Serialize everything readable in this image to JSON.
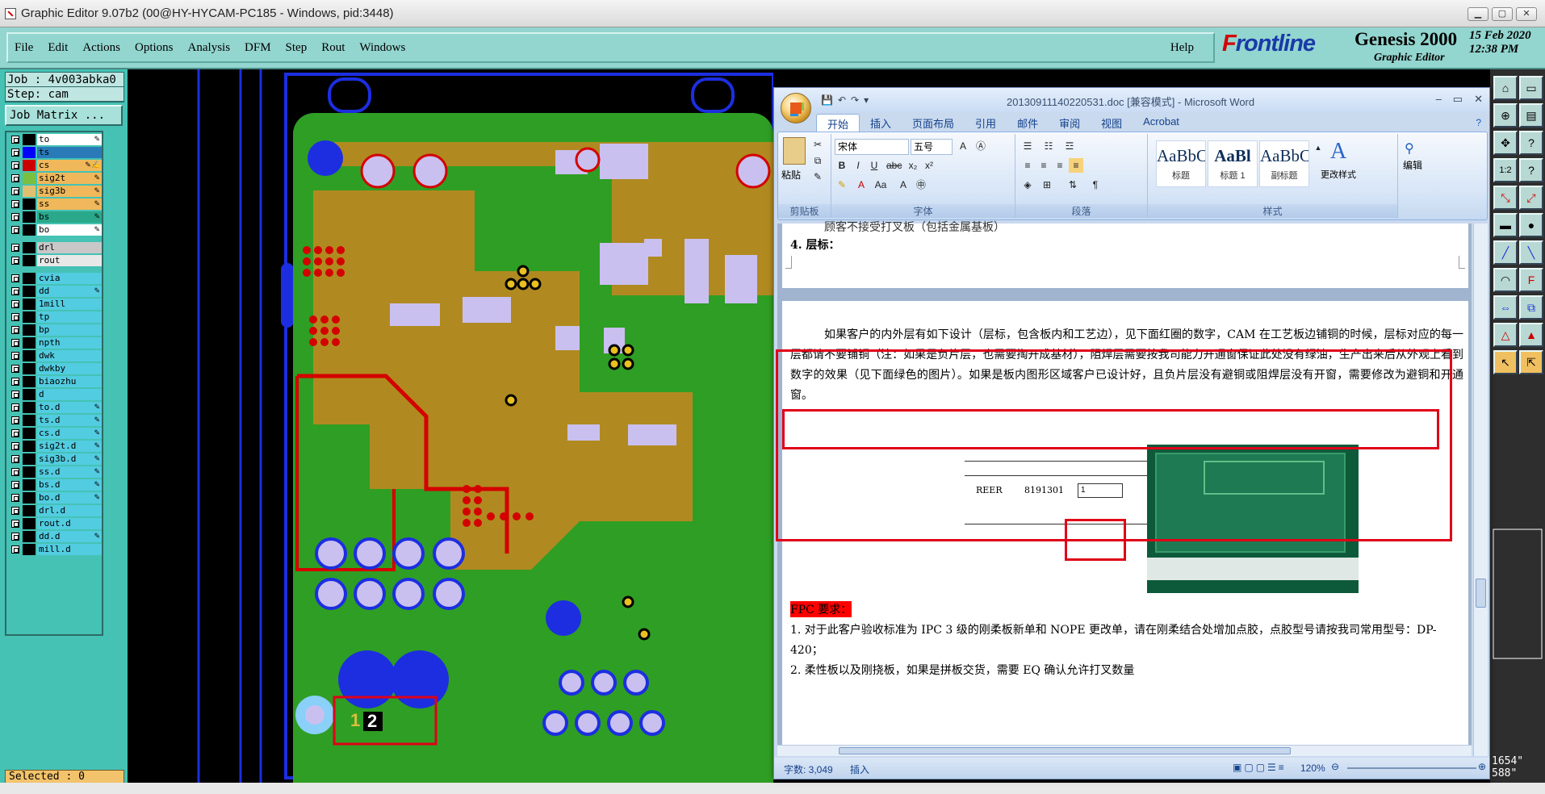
{
  "window": {
    "title": "Graphic Editor 9.07b2 (00@HY-HYCAM-PC185 - Windows, pid:3448)"
  },
  "menu": [
    "File",
    "Edit",
    "Actions",
    "Options",
    "Analysis",
    "DFM",
    "Step",
    "Rout",
    "Windows"
  ],
  "help": "Help",
  "brand": {
    "logo": "Frontline",
    "product": "Genesis 2000",
    "subtitle": "Graphic Editor",
    "date": "15 Feb 2020\n12:38 PM"
  },
  "job": {
    "job": "Job : 4v003abka0",
    "step": "Step: cam",
    "matrix_button": "Job Matrix ..."
  },
  "layers": [
    {
      "name": "to",
      "color": "#ffffff",
      "swatch": "#000000",
      "edit": "✎"
    },
    {
      "name": "ts",
      "color": "#2a7ab8",
      "swatch": "#0000ff",
      "edit": ""
    },
    {
      "name": "cs",
      "color": "#f0b85a",
      "swatch": "#cc0000",
      "edit": "✎✍"
    },
    {
      "name": "sig2t",
      "color": "#f0b85a",
      "swatch": "#7ac040",
      "edit": "✎"
    },
    {
      "name": "sig3b",
      "color": "#f0b85a",
      "swatch": "#e0c070",
      "edit": "✎"
    },
    {
      "name": "ss",
      "color": "#f0b85a",
      "swatch": "#000000",
      "edit": "✎"
    },
    {
      "name": "bs",
      "color": "#2aa88a",
      "swatch": "#000000",
      "edit": "✎"
    },
    {
      "name": "bo",
      "color": "#ffffff",
      "swatch": "#000000",
      "edit": "✎"
    },
    {
      "name": "drl",
      "color": "#c8c8c8",
      "swatch": "#000000",
      "edit": ""
    },
    {
      "name": "rout",
      "color": "#e8e8e8",
      "swatch": "#000000",
      "edit": ""
    },
    {
      "name": "cvia",
      "color": "#52cce0",
      "swatch": "#000000",
      "edit": ""
    },
    {
      "name": "dd",
      "color": "#52cce0",
      "swatch": "#000000",
      "edit": "✎"
    },
    {
      "name": "1mill",
      "color": "#52cce0",
      "swatch": "#000000",
      "edit": ""
    },
    {
      "name": "tp",
      "color": "#52cce0",
      "swatch": "#000000",
      "edit": ""
    },
    {
      "name": "bp",
      "color": "#52cce0",
      "swatch": "#000000",
      "edit": ""
    },
    {
      "name": "npth",
      "color": "#52cce0",
      "swatch": "#000000",
      "edit": ""
    },
    {
      "name": "dwk",
      "color": "#52cce0",
      "swatch": "#000000",
      "edit": ""
    },
    {
      "name": "dwkby",
      "color": "#52cce0",
      "swatch": "#000000",
      "edit": ""
    },
    {
      "name": "biaozhu",
      "color": "#52cce0",
      "swatch": "#000000",
      "edit": ""
    },
    {
      "name": "d",
      "color": "#52cce0",
      "swatch": "#000000",
      "edit": ""
    },
    {
      "name": "to.d",
      "color": "#52cce0",
      "swatch": "#000000",
      "edit": "✎"
    },
    {
      "name": "ts.d",
      "color": "#52cce0",
      "swatch": "#000000",
      "edit": "✎"
    },
    {
      "name": "cs.d",
      "color": "#52cce0",
      "swatch": "#000000",
      "edit": "✎"
    },
    {
      "name": "sig2t.d",
      "color": "#52cce0",
      "swatch": "#000000",
      "edit": "✎"
    },
    {
      "name": "sig3b.d",
      "color": "#52cce0",
      "swatch": "#000000",
      "edit": "✎"
    },
    {
      "name": "ss.d",
      "color": "#52cce0",
      "swatch": "#000000",
      "edit": "✎"
    },
    {
      "name": "bs.d",
      "color": "#52cce0",
      "swatch": "#000000",
      "edit": "✎"
    },
    {
      "name": "bo.d",
      "color": "#52cce0",
      "swatch": "#000000",
      "edit": "✎"
    },
    {
      "name": "drl.d",
      "color": "#52cce0",
      "swatch": "#000000",
      "edit": ""
    },
    {
      "name": "rout.d",
      "color": "#52cce0",
      "swatch": "#000000",
      "edit": ""
    },
    {
      "name": "dd.d",
      "color": "#52cce0",
      "swatch": "#000000",
      "edit": "✎"
    },
    {
      "name": "mill.d",
      "color": "#52cce0",
      "swatch": "#000000",
      "edit": ""
    }
  ],
  "selected": "Selected : 0",
  "coords": "1654\"\n588\"",
  "pcb": {
    "label_1": "1",
    "label_2": "2"
  },
  "word": {
    "title": "20130911140220531.doc [兼容模式] - Microsoft Word",
    "tabs": [
      "开始",
      "插入",
      "页面布局",
      "引用",
      "邮件",
      "审阅",
      "视图",
      "Acrobat"
    ],
    "groups": {
      "clipboard": "剪贴板",
      "font": "字体",
      "paragraph": "段落",
      "styles": "样式",
      "editing": "编辑"
    },
    "paste": "粘贴",
    "font_name": "宋体",
    "font_size": "五号",
    "styles": [
      {
        "sample": "AaBbC",
        "label": "标题"
      },
      {
        "sample": "AaBl",
        "label": "标题 1"
      },
      {
        "sample": "AaBbC",
        "label": "副标题"
      }
    ],
    "change_styles": "更改样式",
    "edit": "编辑",
    "doc": {
      "line0": "顾客不接受打叉板（包括金属基板）",
      "heading4": "4. 层标：",
      "para1": "如果客户的内外层有如下设计（层标，包含板内和工艺边），见下面红圈的数字，CAM 在工艺板边铺铜的时候，层标对应的每一层都请不要铺铜（注：如果是负片层，也需要掏开成基材），阻焊层需要按我司能力开通窗保证此处没有绿油，生产出来后从外观上看到数字的效果（见下面绿色的图片）。如果是板内图形区域客户已设计好，且负片层没有避铜或阻焊层没有开窗，需要修改为避铜和开通窗。",
      "fig_reer": "REER",
      "fig_num": "8191301",
      "fig_box": "1",
      "fpc_title": "FPC 要求：",
      "fpc1": "1. 对于此客户验收标准为 IPC 3 级的刚柔板新单和 NOPE 更改单，请在刚柔结合处增加点胶，点胶型号请按我司常用型号：DP-420；",
      "fpc2": "2. 柔性板以及刚挠板，如果是拼板交货，需要 EQ 确认允许打叉数量"
    },
    "status": {
      "words": "字数: 3,049",
      "insert": "插入",
      "zoom": "120%"
    }
  }
}
